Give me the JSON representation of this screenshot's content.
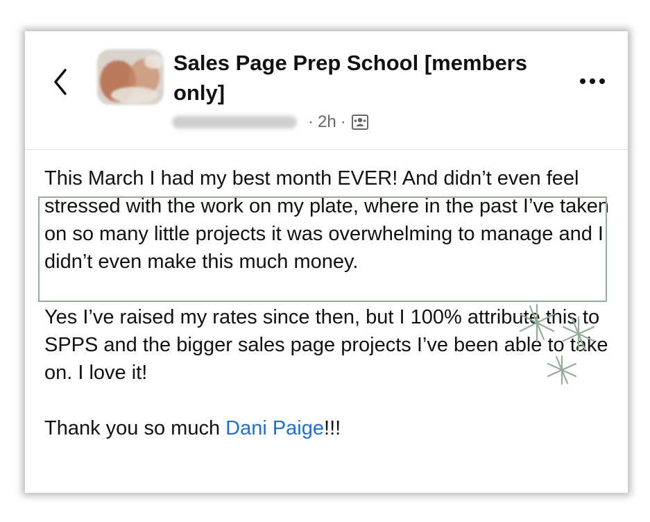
{
  "header": {
    "title": "Sales Page Prep School [members only]",
    "timestamp": "2h",
    "separator": "·",
    "audience_icon": "group-members-icon",
    "back_icon": "chevron-left-icon",
    "more_icon": "more-dots-icon"
  },
  "post": {
    "paragraph_1": "This March I had my best month EVER! And didn’t even feel stressed with the work on my plate, where in the past I’ve taken on so many little projects it was overwhelming to manage and I didn’t even make this much money.",
    "paragraph_2": "Yes I’ve raised my rates since then, but I 100% attribute this to SPPS and the bigger sales page projects I’ve been able to take on. I love it!",
    "thanks_prefix": "Thank you so much ",
    "mention": "Dani Paige",
    "thanks_suffix": "!!!"
  },
  "colors": {
    "mention": "#1b6fd6",
    "highlight_border": "#94ad9b",
    "sparkle": "#94ad9b",
    "meta_text": "#65676b"
  }
}
